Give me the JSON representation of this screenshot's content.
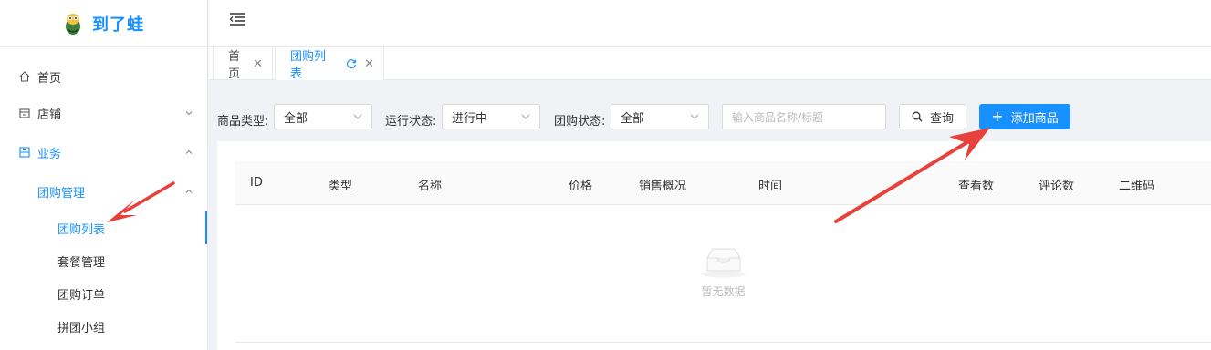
{
  "app": {
    "name": "到了蛙"
  },
  "sidebar": {
    "items": [
      {
        "label": "首页",
        "icon": "home-icon"
      },
      {
        "label": "店铺",
        "icon": "shop-icon"
      },
      {
        "label": "业务",
        "icon": "business-icon"
      }
    ],
    "group": {
      "label": "团购管理"
    },
    "subitems": [
      {
        "label": "团购列表"
      },
      {
        "label": "套餐管理"
      },
      {
        "label": "团购订单"
      },
      {
        "label": "拼团小组"
      }
    ]
  },
  "tabs": [
    {
      "label": "首页"
    },
    {
      "label": "团购列表"
    }
  ],
  "filters": {
    "type_label": "商品类型:",
    "type_value": "全部",
    "run_label": "运行状态:",
    "run_value": "进行中",
    "group_label": "团购状态:",
    "group_value": "全部",
    "search_placeholder": "输入商品名称/标题",
    "query_label": "查询",
    "add_label": "添加商品"
  },
  "table": {
    "columns": [
      "ID",
      "类型",
      "名称",
      "价格",
      "销售概况",
      "时间",
      "查看数",
      "评论数",
      "二维码"
    ],
    "empty_text": "暂无数据"
  },
  "colors": {
    "accent": "#1890ff",
    "annotation_arrow": "#e8413c"
  }
}
